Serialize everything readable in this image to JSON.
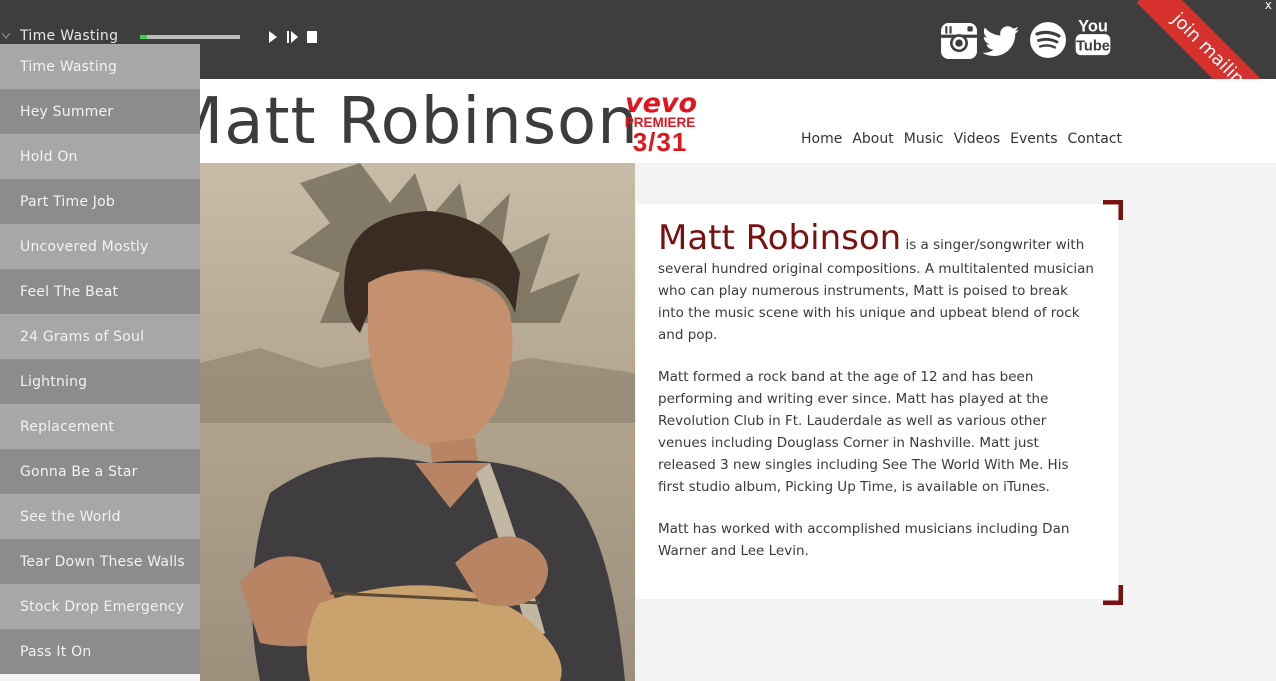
{
  "player": {
    "now_playing": "Time Wasting",
    "progress": 0.07
  },
  "header": {
    "site_title": "Matt Robinson",
    "vevo": {
      "brand": "vevo",
      "line1": "PREMIERE",
      "line2": "3/31"
    },
    "nav": [
      "Home",
      "About",
      "Music",
      "Videos",
      "Events",
      "Contact"
    ]
  },
  "social": [
    "instagram-icon",
    "twitter-icon",
    "spotify-icon",
    "youtube-icon"
  ],
  "social_labels": {
    "youtube_top": "You",
    "youtube_bottom": "Tube"
  },
  "mailing_list": {
    "label": "join mailing list",
    "close": "x"
  },
  "bio": {
    "name": "Matt Robinson",
    "intro": " is a singer/songwriter with several hundred original compositions. A multitalented musician who can play numerous instruments, Matt is poised to break into the music scene with his unique and upbeat blend of rock and pop.",
    "paragraph2": "Matt formed a rock band at the age of 12 and has been performing and writing ever since. Matt has played at the Revolution Club in Ft. Lauderdale as well as various other venues including Douglass Corner in Nashville. Matt just released 3 new singles including See The World With Me. His first studio album, Picking Up Time, is available on iTunes.",
    "paragraph3": "Matt has worked with accomplished musicians including Dan Warner and Lee Levin."
  },
  "playlist": [
    "Time Wasting",
    "Hey Summer",
    "Hold On",
    "Part Time Job",
    "Uncovered Mostly",
    "Feel The Beat",
    "24 Grams of Soul",
    "Lightning",
    "Replacement",
    "Gonna Be a Star",
    "See the World",
    "Tear Down These Walls",
    "Stock Drop Emergency",
    "Pass It On"
  ],
  "colors": {
    "accent": "#7a1111",
    "banner": "#d6312d",
    "progress": "#39d353",
    "vevo": "#e0161f"
  }
}
